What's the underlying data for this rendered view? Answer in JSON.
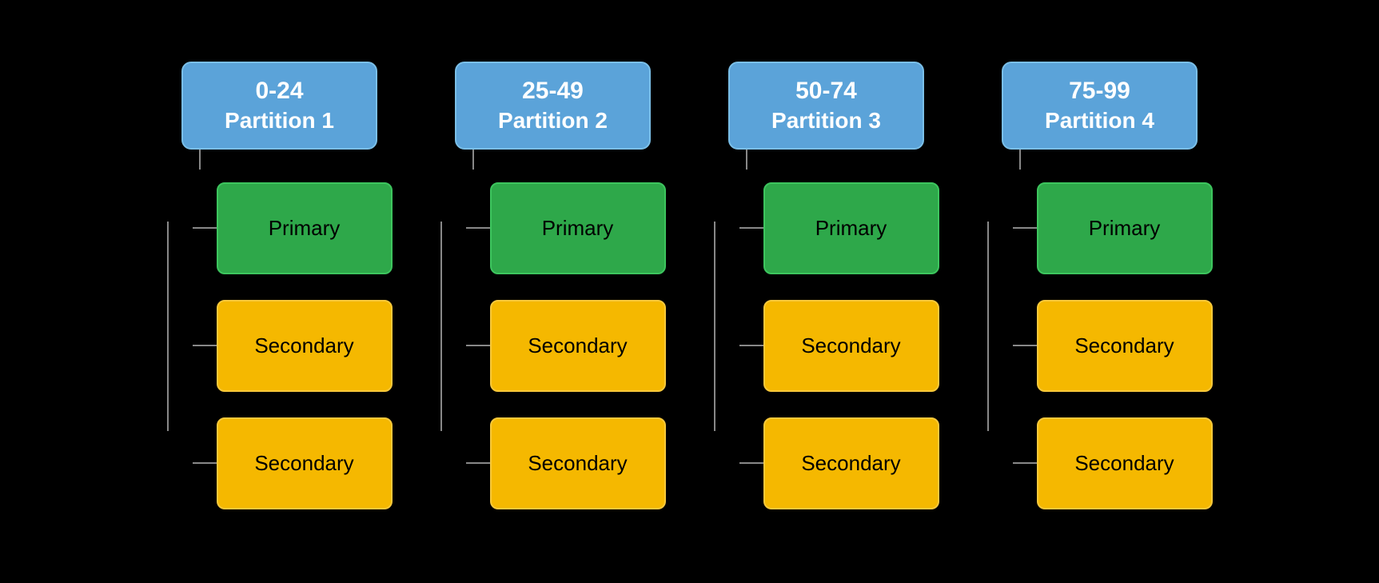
{
  "partitions": [
    {
      "id": "partition-1",
      "range": "0-24",
      "label": "Partition 1",
      "primary_label": "Primary",
      "secondary_label": "Secondary",
      "nodes": [
        {
          "type": "primary",
          "label": "Primary"
        },
        {
          "type": "secondary",
          "label": "Secondary"
        },
        {
          "type": "secondary",
          "label": "Secondary"
        }
      ]
    },
    {
      "id": "partition-2",
      "range": "25-49",
      "label": "Partition 2",
      "primary_label": "Primary",
      "secondary_label": "Secondary",
      "nodes": [
        {
          "type": "primary",
          "label": "Primary"
        },
        {
          "type": "secondary",
          "label": "Secondary"
        },
        {
          "type": "secondary",
          "label": "Secondary"
        }
      ]
    },
    {
      "id": "partition-3",
      "range": "50-74",
      "label": "Partition 3",
      "primary_label": "Primary",
      "secondary_label": "Secondary",
      "nodes": [
        {
          "type": "primary",
          "label": "Primary"
        },
        {
          "type": "secondary",
          "label": "Secondary"
        },
        {
          "type": "secondary",
          "label": "Secondary"
        }
      ]
    },
    {
      "id": "partition-4",
      "range": "75-99",
      "label": "Partition 4",
      "primary_label": "Primary",
      "secondary_label": "Secondary",
      "nodes": [
        {
          "type": "primary",
          "label": "Primary"
        },
        {
          "type": "secondary",
          "label": "Secondary"
        },
        {
          "type": "secondary",
          "label": "Secondary"
        }
      ]
    }
  ],
  "colors": {
    "partition_bg": "#5ba3d9",
    "partition_border": "#7abfe8",
    "primary_bg": "#2ea84a",
    "primary_border": "#3dc55e",
    "secondary_bg": "#f5b800",
    "secondary_border": "#f7c83a",
    "connector": "#888888",
    "background": "#000000",
    "text_light": "#ffffff",
    "text_dark": "#000000"
  }
}
